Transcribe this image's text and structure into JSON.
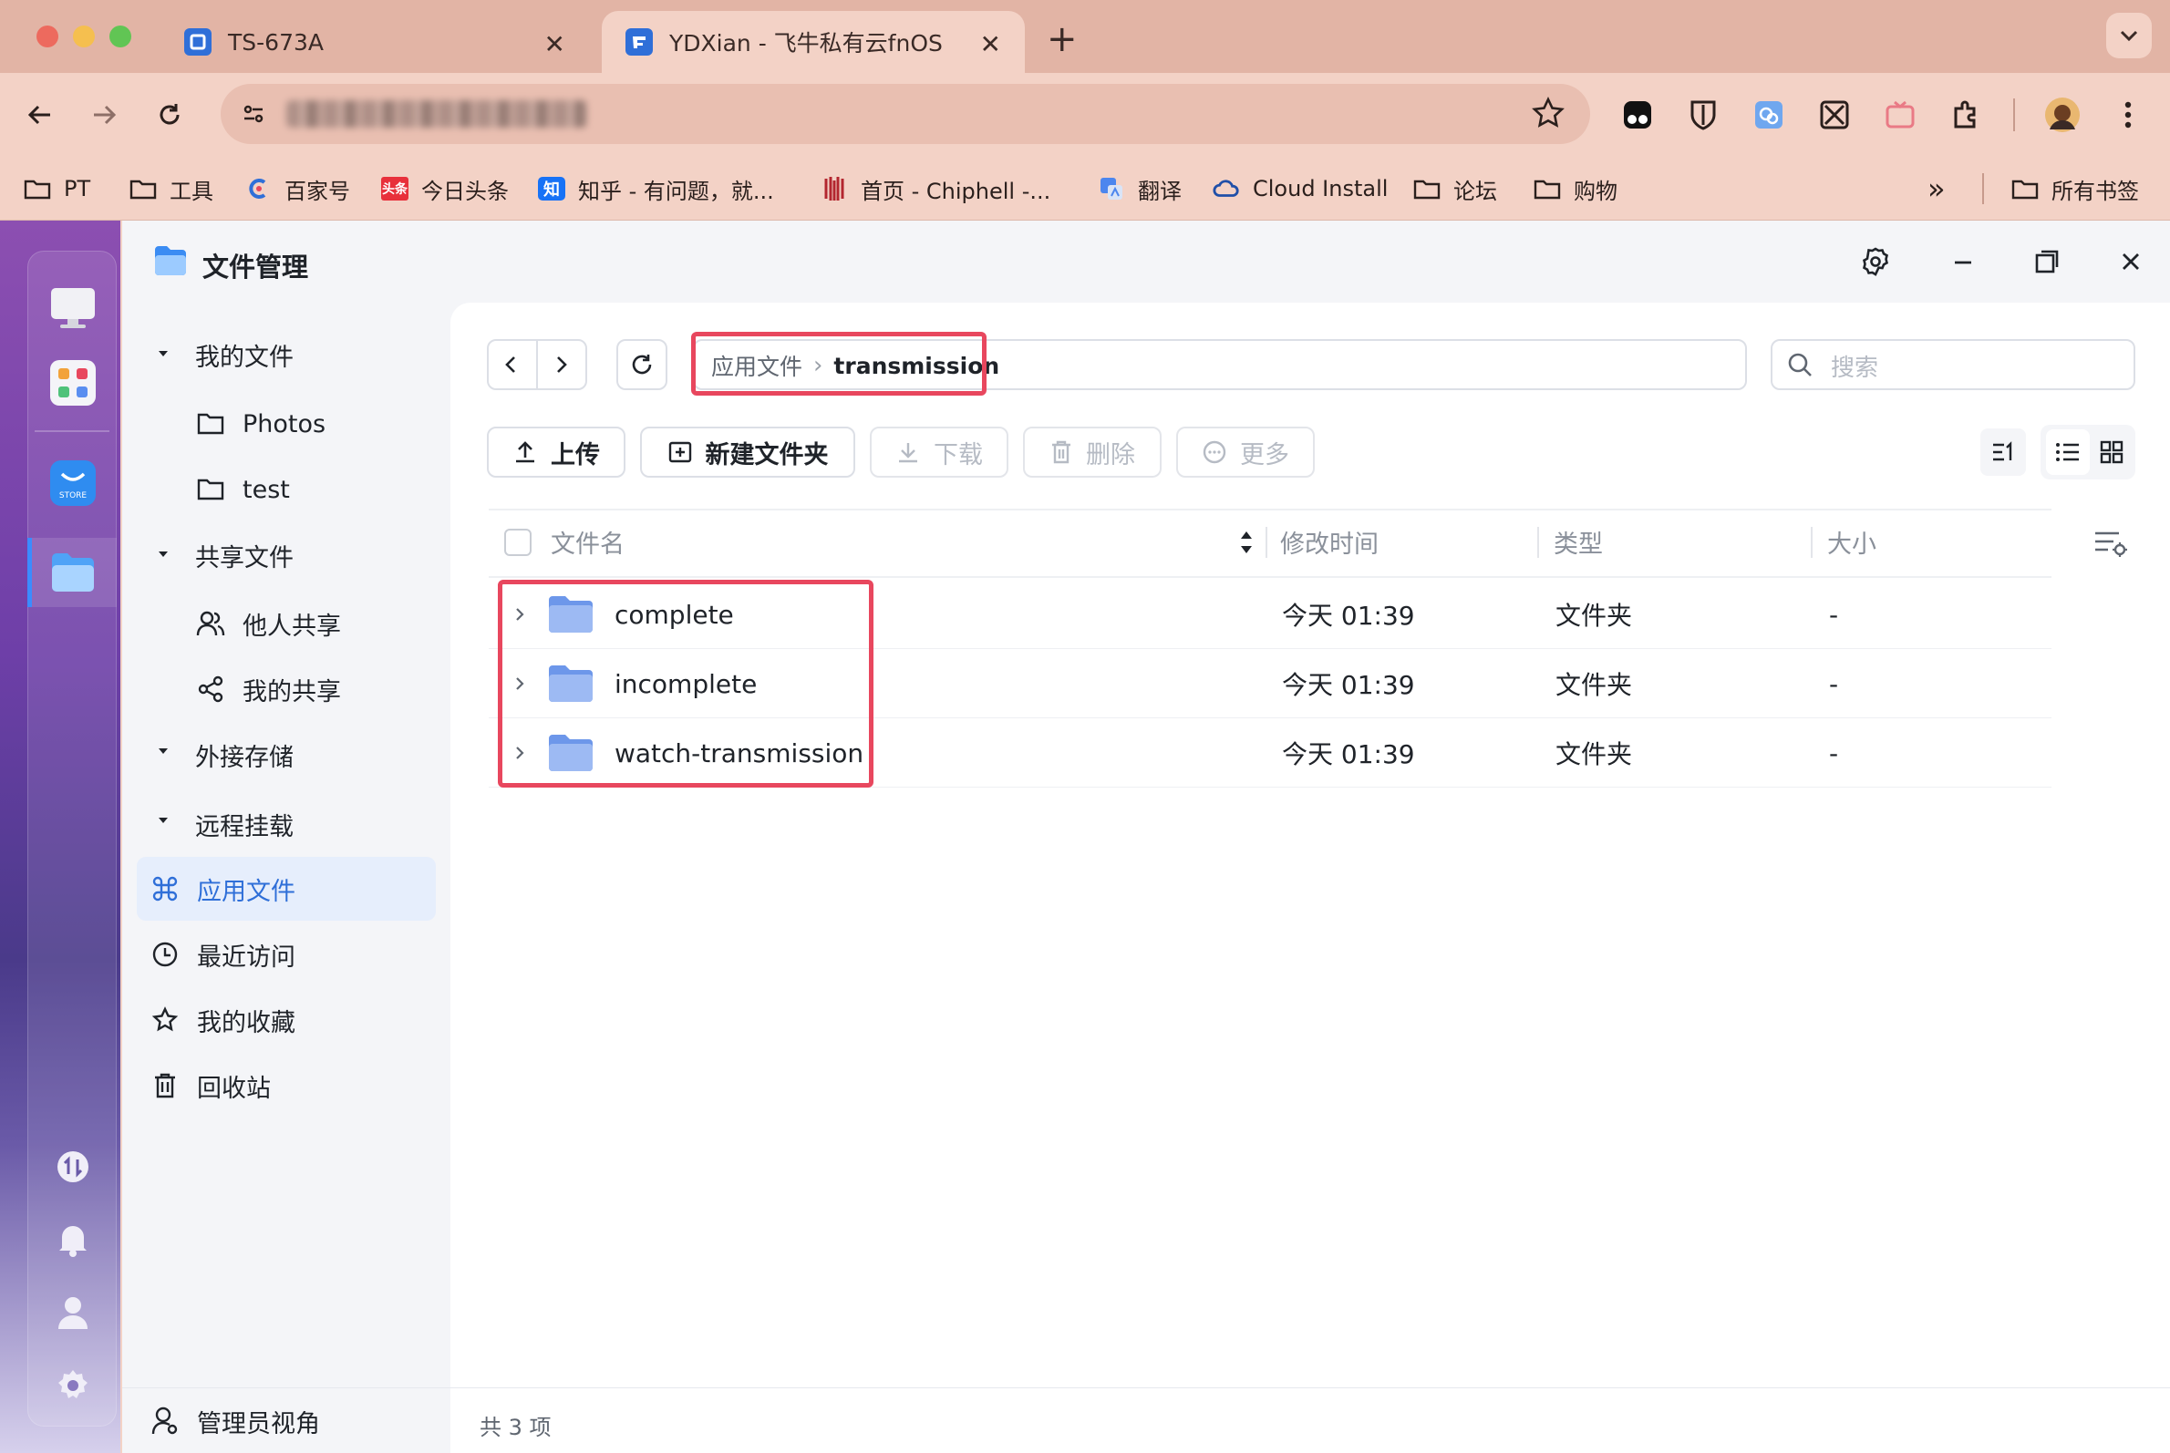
{
  "browser": {
    "tabs": [
      {
        "title": "TS-673A",
        "favicon_color": "#2f6fd8"
      },
      {
        "title": "YDXian - 飞牛私有云fnOS",
        "favicon_color": "#2f6fd8",
        "active": true
      }
    ],
    "new_tab_symbol": "+",
    "close_symbol": "✕",
    "bookmarks": [
      {
        "label": "PT",
        "icon": "folder-icon"
      },
      {
        "label": "工具",
        "icon": "folder-icon"
      },
      {
        "label": "百家号",
        "icon": "baijiahao-icon"
      },
      {
        "label": "今日头条",
        "icon": "toutiao-icon"
      },
      {
        "label": "知乎 - 有问题，就...",
        "icon": "zhihu-icon"
      },
      {
        "label": "首页 - Chiphell -...",
        "icon": "chiphell-icon"
      },
      {
        "label": "翻译",
        "icon": "translate-icon"
      },
      {
        "label": "Cloud Install",
        "icon": "cloud-icon"
      },
      {
        "label": "论坛",
        "icon": "folder-icon"
      },
      {
        "label": "购物",
        "icon": "folder-icon"
      }
    ],
    "more_bookmarks": "»",
    "all_bookmarks": "所有书签",
    "toutiao_badge": "头条",
    "zhihu_badge": "知"
  },
  "app": {
    "title": "文件管理",
    "sidebar": {
      "groups": [
        {
          "label": "我的文件",
          "children": [
            "Photos",
            "test"
          ]
        },
        {
          "label": "共享文件",
          "children": [
            "他人共享",
            "我的共享"
          ]
        },
        {
          "label": "外接存储",
          "children": []
        },
        {
          "label": "远程挂载",
          "children": []
        }
      ],
      "items": [
        {
          "label": "应用文件",
          "active": true
        },
        {
          "label": "最近访问"
        },
        {
          "label": "我的收藏"
        },
        {
          "label": "回收站"
        }
      ],
      "footer": "管理员视角"
    },
    "breadcrumb": [
      "应用文件",
      "transmission"
    ],
    "breadcrumb_sep": "›",
    "search_placeholder": "搜索",
    "toolbar": {
      "upload": "上传",
      "new_folder": "新建文件夹",
      "download": "下载",
      "delete": "删除",
      "more": "更多"
    },
    "table": {
      "columns": [
        "文件名",
        "修改时间",
        "类型",
        "大小"
      ],
      "rows": [
        {
          "name": "complete",
          "modified": "今天 01:39",
          "type": "文件夹",
          "size": "-"
        },
        {
          "name": "incomplete",
          "modified": "今天 01:39",
          "type": "文件夹",
          "size": "-"
        },
        {
          "name": "watch-transmission",
          "modified": "今天 01:39",
          "type": "文件夹",
          "size": "-"
        }
      ]
    },
    "status": "共 3 项",
    "colors": {
      "accent": "#2f6fd8",
      "highlight": "#e8475e",
      "folder": "#8fb1f0"
    }
  },
  "dock": {
    "store_label": "STORE"
  }
}
